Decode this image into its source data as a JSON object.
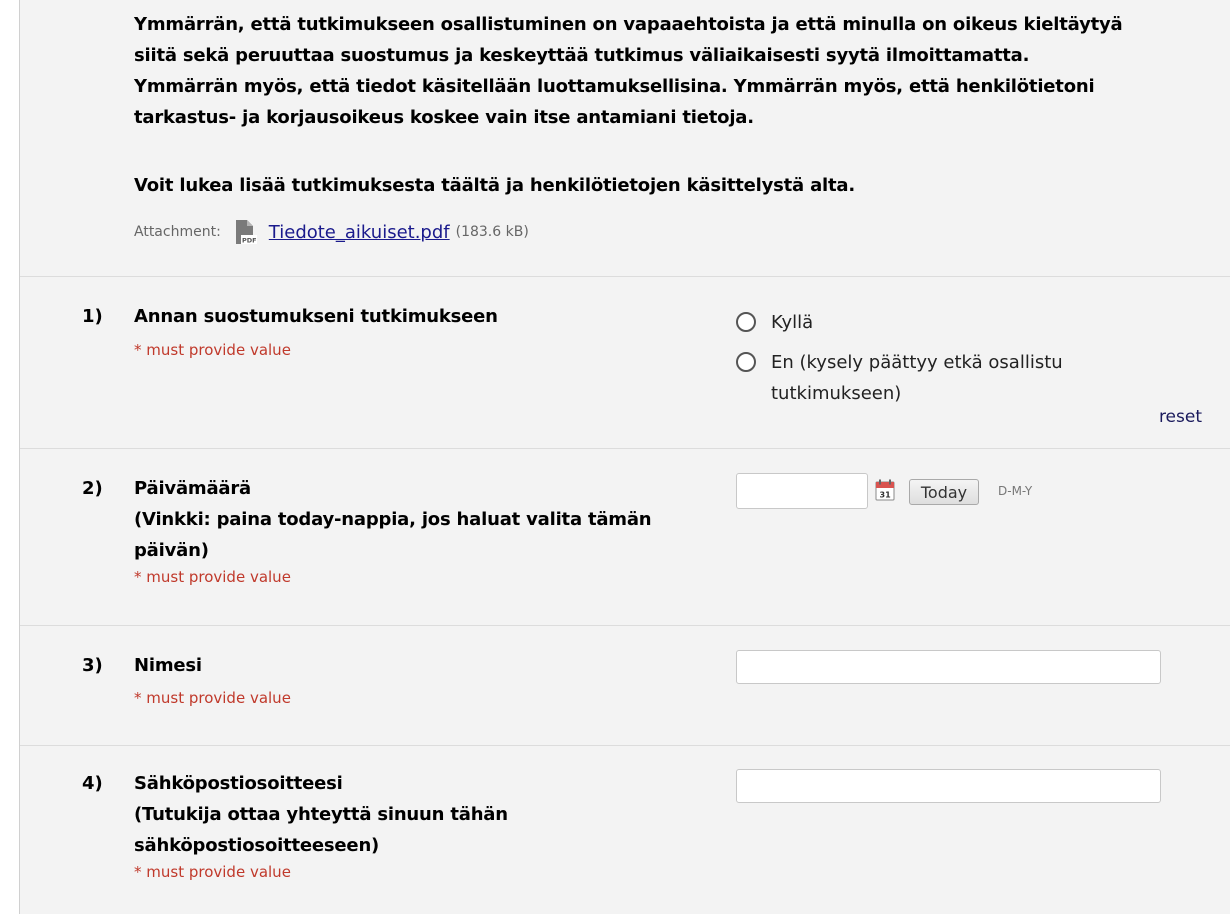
{
  "description": {
    "paragraph1": "Ymmärrän, että tutkimukseen osallistuminen on vapaaehtoista ja että minulla on oikeus kieltäytyä siitä sekä peruuttaa suostumus ja keskeyttää tutkimus väliaikaisesti syytä ilmoittamatta. Ymmärrän myös, että tiedot käsitellään luottamuksellisina. Ymmärrän myös, että henkilötietoni tarkastus- ja korjausoikeus koskee vain itse antamiani tietoja.",
    "paragraph2": "Voit lukea lisää tutkimuksesta täältä ja henkilötietojen käsittelystä alta.",
    "attachment_label": "Attachment:",
    "attachment_file": "Tiedote_aikuiset.pdf",
    "attachment_size": "(183.6 kB)",
    "attachment_icon": "pdf-file-icon"
  },
  "questions": [
    {
      "number": "1)",
      "label": "Annan suostumukseni tutkimukseen",
      "required_note": "* must provide value",
      "type": "radio",
      "options": [
        "Kyllä",
        "En (kysely päättyy etkä osallistu tutkimukseen)"
      ],
      "selected": null,
      "reset_label": "reset"
    },
    {
      "number": "2)",
      "label": "Päivämäärä\n(Vinkki: paina today-nappia, jos haluat valita tämän päivän)",
      "required_note": "* must provide value",
      "type": "date",
      "value": "",
      "calendar_icon": "calendar-icon",
      "today_label": "Today",
      "format_hint": "D-M-Y"
    },
    {
      "number": "3)",
      "label": "Nimesi",
      "required_note": "* must provide value",
      "type": "text",
      "value": ""
    },
    {
      "number": "4)",
      "label": "Sähköpostiosoitteesi\n(Tutukija ottaa yhteyttä sinuun tähän sähköpostiosoitteeseen)",
      "required_note": "* must provide value",
      "type": "text",
      "value": ""
    }
  ],
  "colors": {
    "required_red": "#c0392b",
    "link_blue": "#1a1a8c",
    "panel_background": "#f3f3f3"
  }
}
